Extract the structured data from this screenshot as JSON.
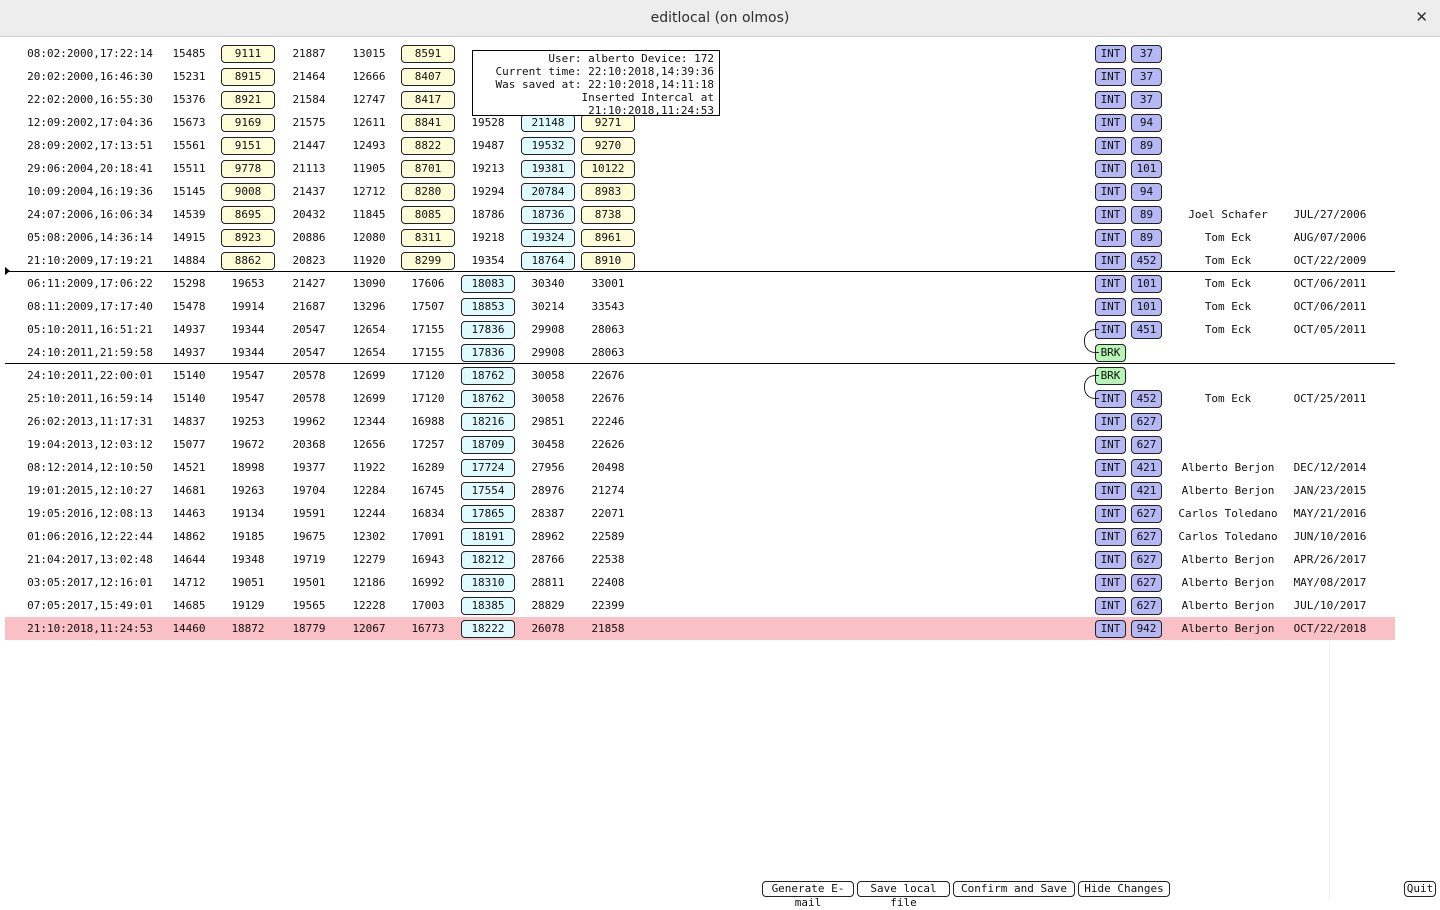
{
  "window": {
    "title": "editlocal (on olmos)",
    "close_glyph": "✕"
  },
  "tooltip": {
    "user_line": "User: alberto Device: 172",
    "current_time": "Current time: 22:10:2018,14:39:36",
    "was_saved": "Was saved at: 22:10:2018,14:11:18",
    "inserted": "Inserted Intercal at 21:10:2018,11:24:53"
  },
  "rows": [
    {
      "date": "08:02:2000,17:22:14",
      "c1": "15485",
      "c2": "9111",
      "c3": "21887",
      "c4": "13015",
      "c5": "8591",
      "c6": "",
      "c7": "",
      "c8": "",
      "type": "INT",
      "num": "37",
      "person": "",
      "pdate": ""
    },
    {
      "date": "20:02:2000,16:46:30",
      "c1": "15231",
      "c2": "8915",
      "c3": "21464",
      "c4": "12666",
      "c5": "8407",
      "c6": "",
      "c7": "",
      "c8": "",
      "type": "INT",
      "num": "37",
      "person": "",
      "pdate": ""
    },
    {
      "date": "22:02:2000,16:55:30",
      "c1": "15376",
      "c2": "8921",
      "c3": "21584",
      "c4": "12747",
      "c5": "8417",
      "c6": "",
      "c7": "",
      "c8": "",
      "type": "INT",
      "num": "37",
      "person": "",
      "pdate": ""
    },
    {
      "date": "12:09:2002,17:04:36",
      "c1": "15673",
      "c2": "9169",
      "c3": "21575",
      "c4": "12611",
      "c5": "8841",
      "c6": "19528",
      "c7": "21148",
      "c8": "9271",
      "type": "INT",
      "num": "94",
      "person": "",
      "pdate": ""
    },
    {
      "date": "28:09:2002,17:13:51",
      "c1": "15561",
      "c2": "9151",
      "c3": "21447",
      "c4": "12493",
      "c5": "8822",
      "c6": "19487",
      "c7": "19532",
      "c8": "9270",
      "type": "INT",
      "num": "89",
      "person": "",
      "pdate": ""
    },
    {
      "date": "29:06:2004,20:18:41",
      "c1": "15511",
      "c2": "9778",
      "c3": "21113",
      "c4": "11905",
      "c5": "8701",
      "c6": "19213",
      "c7": "19381",
      "c8": "10122",
      "type": "INT",
      "num": "101",
      "person": "",
      "pdate": ""
    },
    {
      "date": "10:09:2004,16:19:36",
      "c1": "15145",
      "c2": "9008",
      "c3": "21437",
      "c4": "12712",
      "c5": "8280",
      "c6": "19294",
      "c7": "20784",
      "c8": "8983",
      "type": "INT",
      "num": "94",
      "person": "",
      "pdate": ""
    },
    {
      "date": "24:07:2006,16:06:34",
      "c1": "14539",
      "c2": "8695",
      "c3": "20432",
      "c4": "11845",
      "c5": "8085",
      "c6": "18786",
      "c7": "18736",
      "c8": "8738",
      "type": "INT",
      "num": "89",
      "person": "Joel Schafer",
      "pdate": "JUL/27/2006"
    },
    {
      "date": "05:08:2006,14:36:14",
      "c1": "14915",
      "c2": "8923",
      "c3": "20886",
      "c4": "12080",
      "c5": "8311",
      "c6": "19218",
      "c7": "19324",
      "c8": "8961",
      "type": "INT",
      "num": "89",
      "person": "Tom Eck",
      "pdate": "AUG/07/2006"
    },
    {
      "date": "21:10:2009,17:19:21",
      "c1": "14884",
      "c2": "8862",
      "c3": "20823",
      "c4": "11920",
      "c5": "8299",
      "c6": "19354",
      "c7": "18764",
      "c8": "8910",
      "type": "INT",
      "num": "452",
      "person": "Tom Eck",
      "pdate": "OCT/22/2009"
    },
    {
      "date": "06:11:2009,17:06:22",
      "c1": "15298",
      "c2": "19653",
      "c3": "21427",
      "c4": "13090",
      "c5": "17606",
      "c6": "18083",
      "c7": "30340",
      "c8": "33001",
      "type": "INT",
      "num": "101",
      "person": "Tom Eck",
      "pdate": "OCT/06/2011"
    },
    {
      "date": "08:11:2009,17:17:40",
      "c1": "15478",
      "c2": "19914",
      "c3": "21687",
      "c4": "13296",
      "c5": "17507",
      "c6": "18853",
      "c7": "30214",
      "c8": "33543",
      "type": "INT",
      "num": "101",
      "person": "Tom Eck",
      "pdate": "OCT/06/2011"
    },
    {
      "date": "05:10:2011,16:51:21",
      "c1": "14937",
      "c2": "19344",
      "c3": "20547",
      "c4": "12654",
      "c5": "17155",
      "c6": "17836",
      "c7": "29908",
      "c8": "28063",
      "type": "INT",
      "num": "451",
      "person": "Tom Eck",
      "pdate": "OCT/05/2011"
    },
    {
      "date": "24:10:2011,21:59:58",
      "c1": "14937",
      "c2": "19344",
      "c3": "20547",
      "c4": "12654",
      "c5": "17155",
      "c6": "17836",
      "c7": "29908",
      "c8": "28063",
      "type": "BRK",
      "num": "",
      "person": "",
      "pdate": ""
    },
    {
      "date": "24:10:2011,22:00:01",
      "c1": "15140",
      "c2": "19547",
      "c3": "20578",
      "c4": "12699",
      "c5": "17120",
      "c6": "18762",
      "c7": "30058",
      "c8": "22676",
      "type": "BRK",
      "num": "",
      "person": "",
      "pdate": ""
    },
    {
      "date": "25:10:2011,16:59:14",
      "c1": "15140",
      "c2": "19547",
      "c3": "20578",
      "c4": "12699",
      "c5": "17120",
      "c6": "18762",
      "c7": "30058",
      "c8": "22676",
      "type": "INT",
      "num": "452",
      "person": "Tom Eck",
      "pdate": "OCT/25/2011"
    },
    {
      "date": "26:02:2013,11:17:31",
      "c1": "14837",
      "c2": "19253",
      "c3": "19962",
      "c4": "12344",
      "c5": "16988",
      "c6": "18216",
      "c7": "29851",
      "c8": "22246",
      "type": "INT",
      "num": "627",
      "person": "",
      "pdate": ""
    },
    {
      "date": "19:04:2013,12:03:12",
      "c1": "15077",
      "c2": "19672",
      "c3": "20368",
      "c4": "12656",
      "c5": "17257",
      "c6": "18709",
      "c7": "30458",
      "c8": "22626",
      "type": "INT",
      "num": "627",
      "person": "",
      "pdate": ""
    },
    {
      "date": "08:12:2014,12:10:50",
      "c1": "14521",
      "c2": "18998",
      "c3": "19377",
      "c4": "11922",
      "c5": "16289",
      "c6": "17724",
      "c7": "27956",
      "c8": "20498",
      "type": "INT",
      "num": "421",
      "person": "Alberto Berjon",
      "pdate": "DEC/12/2014"
    },
    {
      "date": "19:01:2015,12:10:27",
      "c1": "14681",
      "c2": "19263",
      "c3": "19704",
      "c4": "12284",
      "c5": "16745",
      "c6": "17554",
      "c7": "28976",
      "c8": "21274",
      "type": "INT",
      "num": "421",
      "person": "Alberto Berjon",
      "pdate": "JAN/23/2015"
    },
    {
      "date": "19:05:2016,12:08:13",
      "c1": "14463",
      "c2": "19134",
      "c3": "19591",
      "c4": "12244",
      "c5": "16834",
      "c6": "17865",
      "c7": "28387",
      "c8": "22071",
      "type": "INT",
      "num": "627",
      "person": "Carlos Toledano",
      "pdate": "MAY/21/2016"
    },
    {
      "date": "01:06:2016,12:22:44",
      "c1": "14862",
      "c2": "19185",
      "c3": "19675",
      "c4": "12302",
      "c5": "17091",
      "c6": "18191",
      "c7": "28962",
      "c8": "22589",
      "type": "INT",
      "num": "627",
      "person": "Carlos Toledano",
      "pdate": "JUN/10/2016"
    },
    {
      "date": "21:04:2017,13:02:48",
      "c1": "14644",
      "c2": "19348",
      "c3": "19719",
      "c4": "12279",
      "c5": "16943",
      "c6": "18212",
      "c7": "28766",
      "c8": "22538",
      "type": "INT",
      "num": "627",
      "person": "Alberto Berjon",
      "pdate": "APR/26/2017"
    },
    {
      "date": "03:05:2017,12:16:01",
      "c1": "14712",
      "c2": "19051",
      "c3": "19501",
      "c4": "12186",
      "c5": "16992",
      "c6": "18310",
      "c7": "28811",
      "c8": "22408",
      "type": "INT",
      "num": "627",
      "person": "Alberto Berjon",
      "pdate": "MAY/08/2017"
    },
    {
      "date": "07:05:2017,15:49:01",
      "c1": "14685",
      "c2": "19129",
      "c3": "19565",
      "c4": "12228",
      "c5": "17003",
      "c6": "18385",
      "c7": "28829",
      "c8": "22399",
      "type": "INT",
      "num": "627",
      "person": "Alberto Berjon",
      "pdate": "JUL/10/2017"
    },
    {
      "date": "21:10:2018,11:24:53",
      "c1": "14460",
      "c2": "18872",
      "c3": "18779",
      "c4": "12067",
      "c5": "16773",
      "c6": "18222",
      "c7": "26078",
      "c8": "21858",
      "type": "INT",
      "num": "942",
      "person": "Alberto Berjon",
      "pdate": "OCT/22/2018"
    }
  ],
  "buttons": {
    "generate_email": "Generate E-mail",
    "save_local": "Save local file",
    "confirm_save": "Confirm and Save",
    "hide_changes": "Hide Changes",
    "quit": "Quit"
  },
  "colors": {
    "highlight_row": "#f9c0c5",
    "yellow_box": "#fffdd8",
    "cyan_box": "#e0fbff",
    "int_badge": "#b5b8f5",
    "brk_badge": "#b6f5b6"
  }
}
